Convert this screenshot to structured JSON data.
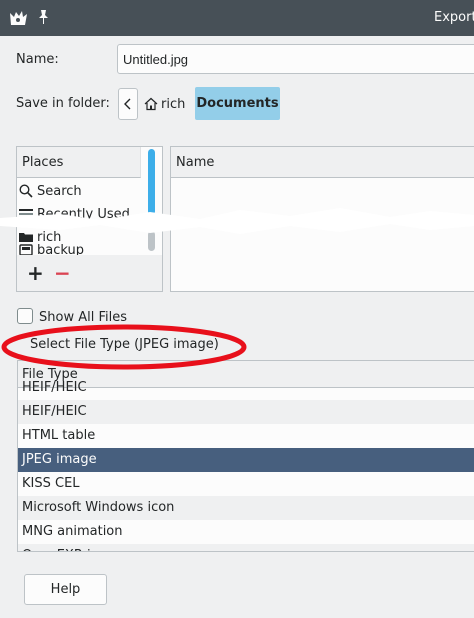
{
  "window": {
    "title": "Export",
    "app_icon": "gimp-icon",
    "pin_icon": "pin-icon"
  },
  "name_row": {
    "label": "Name:",
    "value": "Untitled.jpg"
  },
  "folder_row": {
    "label": "Save in folder:",
    "back_icon": "chevron-left-icon",
    "home_icon": "home-icon",
    "crumbs": [
      "rich",
      "Documents"
    ]
  },
  "places": {
    "header": "Places",
    "items": [
      {
        "label": "Search",
        "icon": "search-icon"
      },
      {
        "label": "Recently Used",
        "icon": "recent-icon"
      },
      {
        "label": "rich",
        "icon": "home-folder-icon"
      },
      {
        "label": "backup",
        "icon": "drive-icon"
      }
    ],
    "add_label": "+",
    "remove_label": "−"
  },
  "files": {
    "name_header": "Name"
  },
  "show_all_files": {
    "label": "Show All Files",
    "checked": false
  },
  "file_type_expander": {
    "label": "Select File Type (JPEG image)"
  },
  "file_types": {
    "header": "File Type",
    "rows": [
      "HEIF/HEIC",
      "HEIF/HEIC",
      "HTML table",
      "JPEG image",
      "KISS CEL",
      "Microsoft Windows icon",
      "MNG animation",
      "OpenEXR image"
    ],
    "selected": "JPEG image"
  },
  "help_button": {
    "label": "Help"
  },
  "colors": {
    "titlebar": "#475057",
    "selection": "#475f7e",
    "crumb_active": "#93cee9",
    "scroll_accent": "#3daee9",
    "annotation": "#e8101b"
  }
}
